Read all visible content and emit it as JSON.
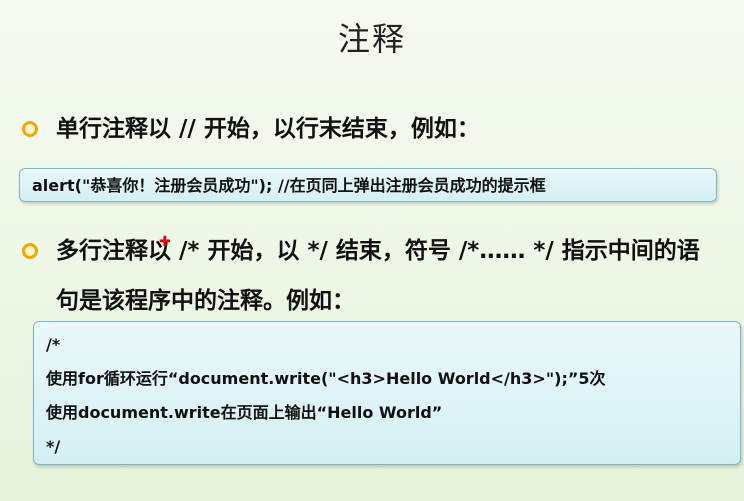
{
  "slide": {
    "title": "注释"
  },
  "bullet1": {
    "text": "单行注释以 // 开始，以行末结束，例如："
  },
  "code1": {
    "line": "alert(\"恭喜你！注册会员成功\"); //在页同上弹出注册会员成功的提示框"
  },
  "bullet2": {
    "text": "多行注释以 /* 开始，以 */ 结束，符号 /*…… */ 指示中间的语句是该程序中的注释。例如："
  },
  "code2": {
    "lines": [
      "/*",
      "使用for循环运行“document.write(\"<h3>Hello World</h3>\");”5次",
      "使用document.write在页面上输出“Hello World”",
      "*/"
    ]
  },
  "colors": {
    "bullet": "#f0a800",
    "code_box_border": "#7fb8c2",
    "cursor": "#e00000"
  }
}
